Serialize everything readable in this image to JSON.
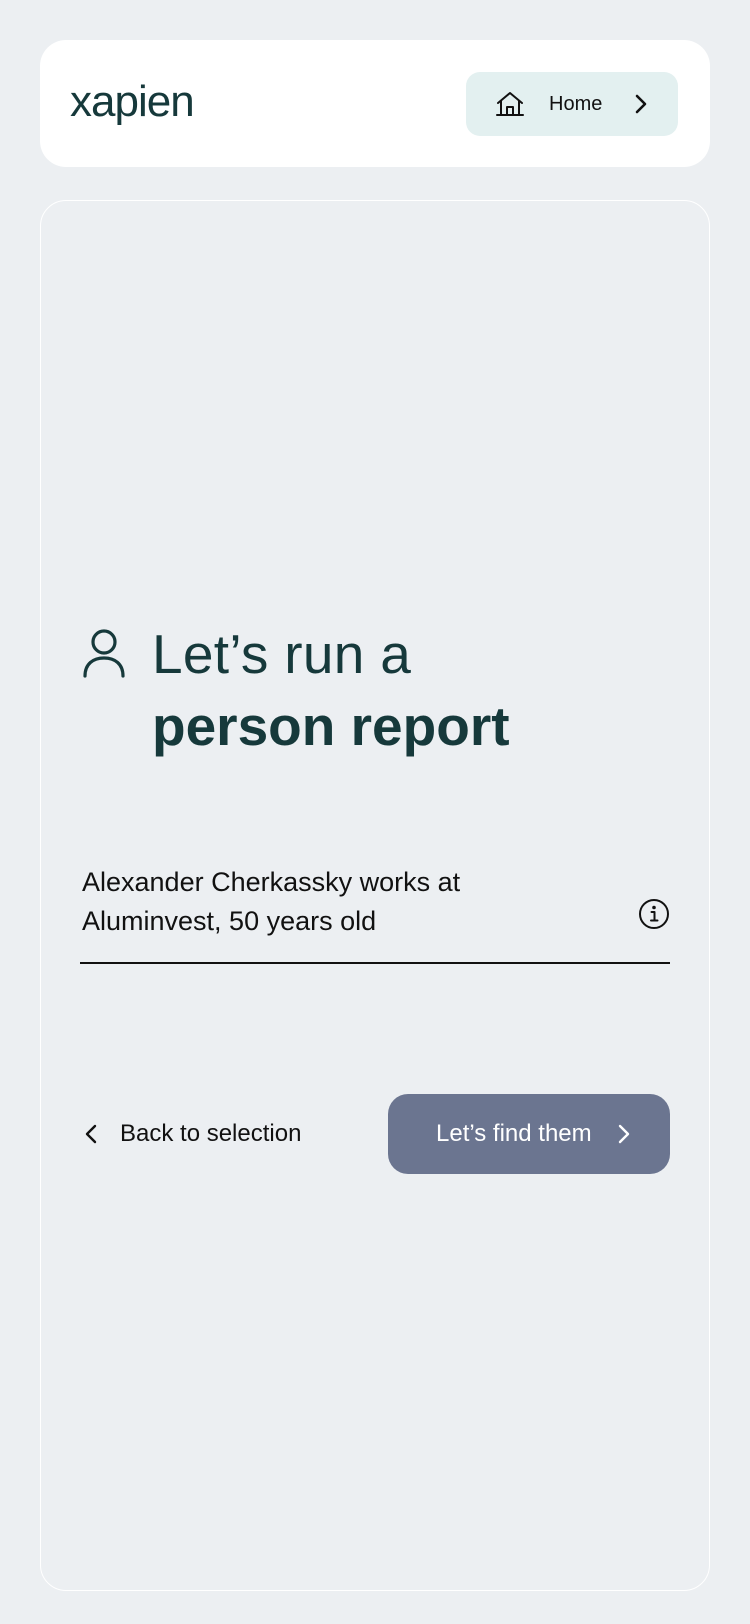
{
  "header": {
    "logo_text": "xapien",
    "home_label": "Home",
    "icons": {
      "home": "home-icon",
      "chevron": "chevron-right-icon"
    }
  },
  "main": {
    "title_line1": "Let’s run a",
    "title_line2": "person report",
    "icon": "person-icon",
    "query_text": "Alexander Cherkassky works at Aluminvest, 50 years old",
    "info_icon": "info-icon",
    "back_label": "Back to selection",
    "submit_label": "Let’s find them"
  },
  "colors": {
    "background": "#ECEFF2",
    "header_bg": "#FFFFFF",
    "brand": "#16393B",
    "home_button_bg": "#E3F0F0",
    "submit_button_bg": "#6B7590",
    "text": "#111111"
  }
}
